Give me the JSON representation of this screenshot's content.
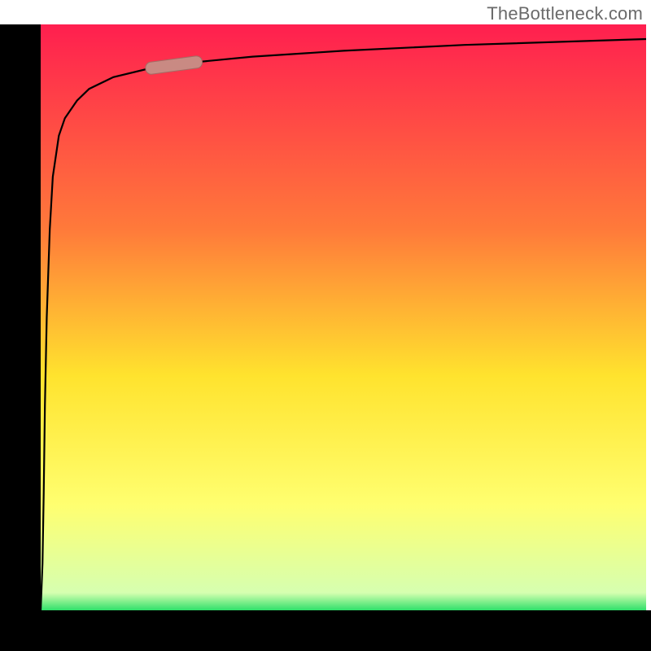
{
  "watermark": "TheBottleneck.com",
  "colors": {
    "black": "#000000",
    "curve": "#000000",
    "marker": "#c98a83",
    "marker_stroke": "#a46a63",
    "gradient_top": "#ff1f4f",
    "gradient_mid1": "#ff7a3a",
    "gradient_mid2": "#ffe32e",
    "gradient_mid3": "#ffff70",
    "gradient_bottom": "#2fe06a"
  },
  "chart_data": {
    "type": "line",
    "title": "",
    "xlabel": "",
    "ylabel": "",
    "xlim": [
      0,
      100
    ],
    "ylim": [
      0,
      100
    ],
    "legend": "none",
    "grid": false,
    "annotations": [],
    "series": [
      {
        "name": "curve",
        "x": [
          0,
          0.3,
          0.5,
          0.7,
          1,
          1.5,
          2,
          3,
          4,
          6,
          8,
          12,
          18,
          25,
          35,
          50,
          70,
          100
        ],
        "y": [
          0,
          8,
          20,
          35,
          50,
          65,
          74,
          81,
          84,
          87,
          89,
          91,
          92.5,
          93.5,
          94.5,
          95.5,
          96.5,
          97.5
        ]
      }
    ],
    "marker": {
      "x_range": [
        18,
        26
      ],
      "y_range": [
        89.5,
        92.5
      ]
    },
    "background_gradient": {
      "direction": "vertical",
      "stops": [
        {
          "offset": 0.0,
          "color": "#ff1f4f"
        },
        {
          "offset": 0.35,
          "color": "#ff7a3a"
        },
        {
          "offset": 0.6,
          "color": "#ffe32e"
        },
        {
          "offset": 0.82,
          "color": "#ffff70"
        },
        {
          "offset": 0.97,
          "color": "#d6ffb0"
        },
        {
          "offset": 1.0,
          "color": "#2fe06a"
        }
      ]
    },
    "frame": {
      "thick_left": true,
      "thick_bottom": true,
      "thickness_px": 50
    }
  }
}
